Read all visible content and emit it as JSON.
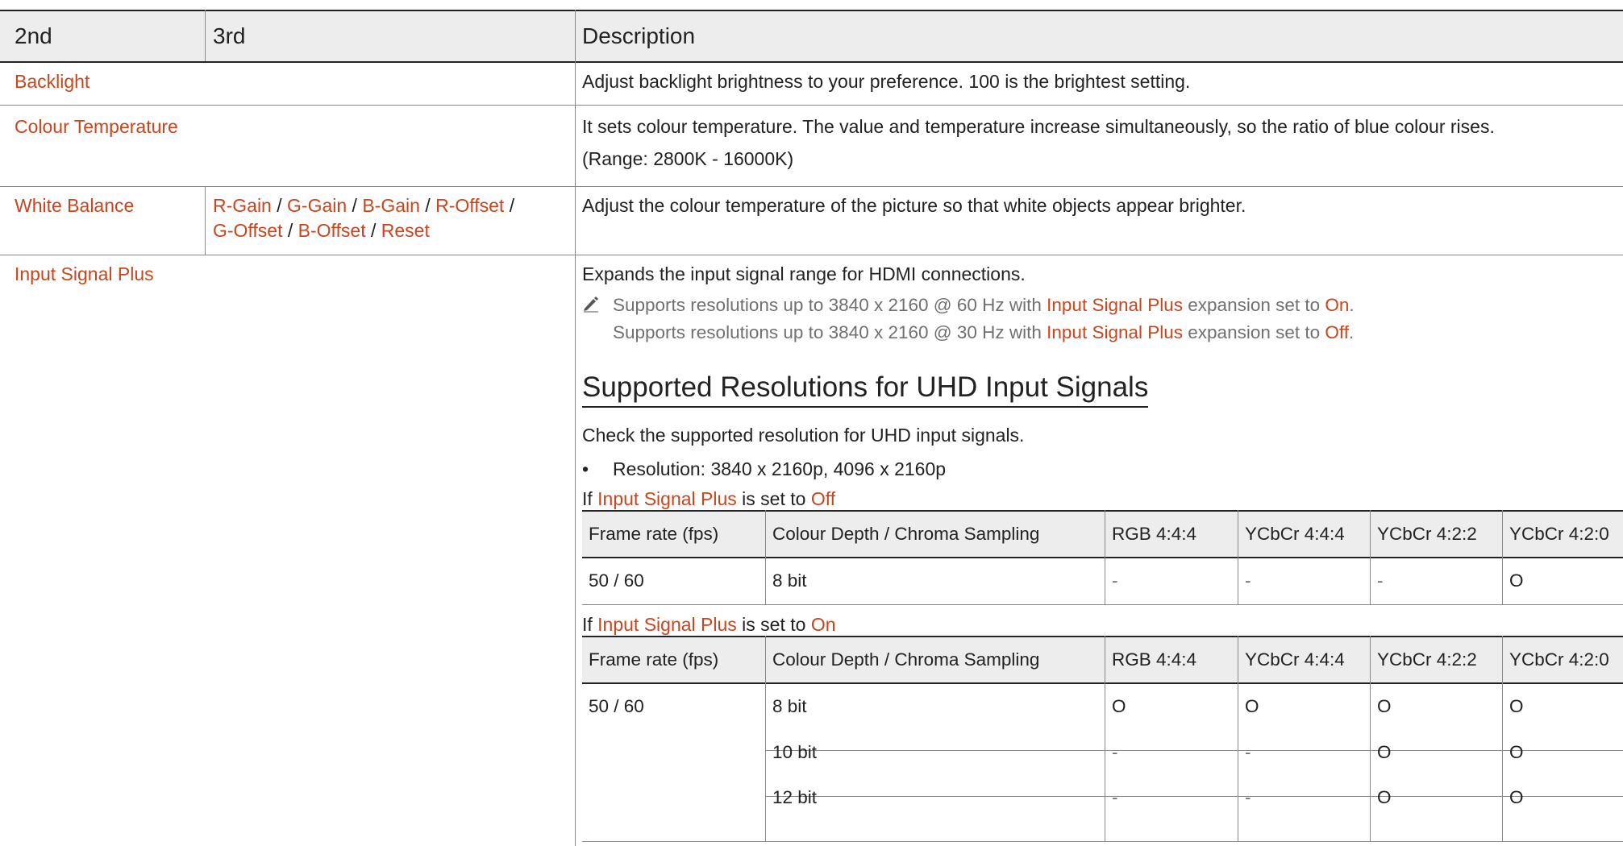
{
  "table": {
    "headers": [
      "2nd",
      "3rd",
      "Description"
    ],
    "backlight": {
      "label": "Backlight",
      "description": "Adjust backlight brightness to your preference. 100 is the brightest setting."
    },
    "colour_temperature": {
      "label": "Colour Temperature",
      "description": "It sets colour temperature. The value and temperature increase simultaneously, so the ratio of blue colour rises.",
      "range": "(Range: 2800K - 16000K)"
    },
    "white_balance": {
      "label": "White Balance",
      "options": [
        "R-Gain",
        "G-Gain",
        "B-Gain",
        "R-Offset",
        "G-Offset",
        "B-Offset",
        "Reset"
      ],
      "separator": " / ",
      "description": "Adjust the colour temperature of the picture so that white objects appear brighter."
    },
    "input_signal_plus": {
      "label": "Input Signal Plus",
      "description": "Expands the input signal range for HDMI connections.",
      "note1": {
        "prefix": "Supports resolutions up to 3840 x 2160 @ 60 Hz with ",
        "term": "Input Signal Plus",
        "mid": " expansion set to ",
        "value": "On",
        "end": "."
      },
      "note2": {
        "prefix": "Supports resolutions up to 3840 x 2160 @ 30 Hz with ",
        "term": "Input Signal Plus",
        "mid": " expansion set to ",
        "value": "Off",
        "end": "."
      },
      "section_title": "Supported Resolutions for UHD Input Signals",
      "section_intro": "Check the supported resolution for UHD input signals.",
      "bullet": "Resolution: 3840 x 2160p, 4096 x 2160p",
      "cond_off": {
        "prefix": "If ",
        "term": "Input Signal Plus",
        "mid": " is set to ",
        "value": "Off"
      },
      "cond_on": {
        "prefix": "If ",
        "term": "Input Signal Plus",
        "mid": " is set to ",
        "value": "On"
      }
    }
  },
  "subtable_headers": [
    "Frame rate (fps)",
    "Colour Depth / Chroma Sampling",
    "RGB 4:4:4",
    "YCbCr 4:4:4",
    "YCbCr 4:2:2",
    "YCbCr 4:2:0"
  ],
  "subtable_off": {
    "rows": [
      {
        "fps": "50 / 60",
        "depth": "8 bit",
        "vals": [
          "-",
          "-",
          "-",
          "O"
        ]
      }
    ]
  },
  "subtable_on": {
    "fps": "50 / 60",
    "rows": [
      {
        "depth": "8 bit",
        "vals": [
          "O",
          "O",
          "O",
          "O"
        ]
      },
      {
        "depth": "10 bit",
        "vals": [
          "-",
          "-",
          "O",
          "O"
        ]
      },
      {
        "depth": "12 bit",
        "vals": [
          "-",
          "-",
          "O",
          "O"
        ]
      }
    ]
  },
  "colors": {
    "accent": "#c8461e",
    "header_bg": "#ededed",
    "note_text": "#707070"
  },
  "icons": {
    "note": "pencil-icon",
    "bullet": "bullet-dot"
  }
}
